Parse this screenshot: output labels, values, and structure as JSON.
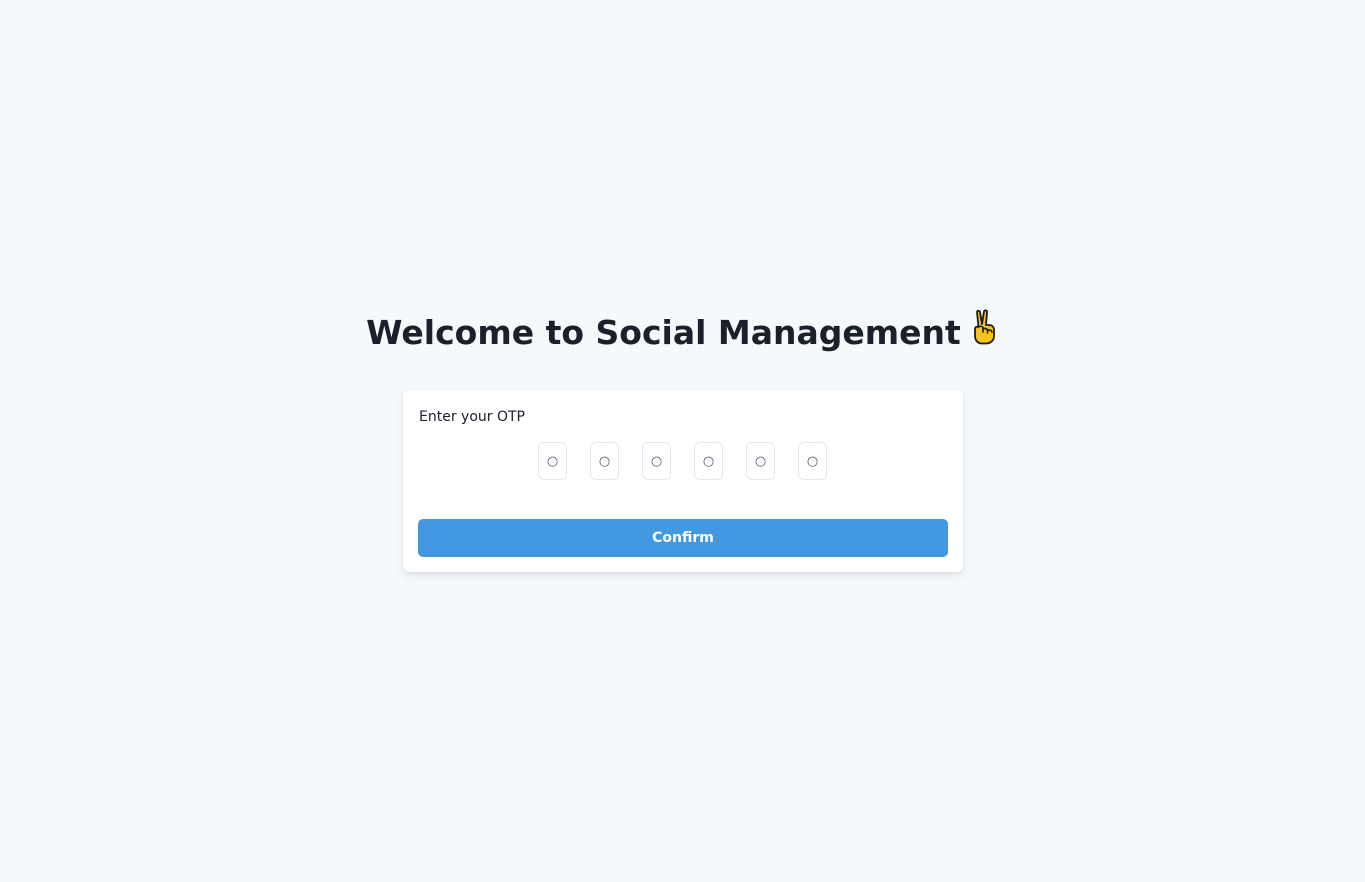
{
  "header": {
    "title": "Welcome to Social Management",
    "emoji_icon": "victory-hand-icon"
  },
  "otp_form": {
    "label": "Enter your OTP",
    "inputs": [
      {
        "placeholder": "○",
        "value": ""
      },
      {
        "placeholder": "○",
        "value": ""
      },
      {
        "placeholder": "○",
        "value": ""
      },
      {
        "placeholder": "○",
        "value": ""
      },
      {
        "placeholder": "○",
        "value": ""
      },
      {
        "placeholder": "○",
        "value": ""
      }
    ],
    "confirm_label": "Confirm"
  },
  "colors": {
    "background": "#f5f9fc",
    "card": "#ffffff",
    "primary_button": "#4299e1",
    "text": "#1a202c",
    "input_border": "#e2e8f0"
  }
}
